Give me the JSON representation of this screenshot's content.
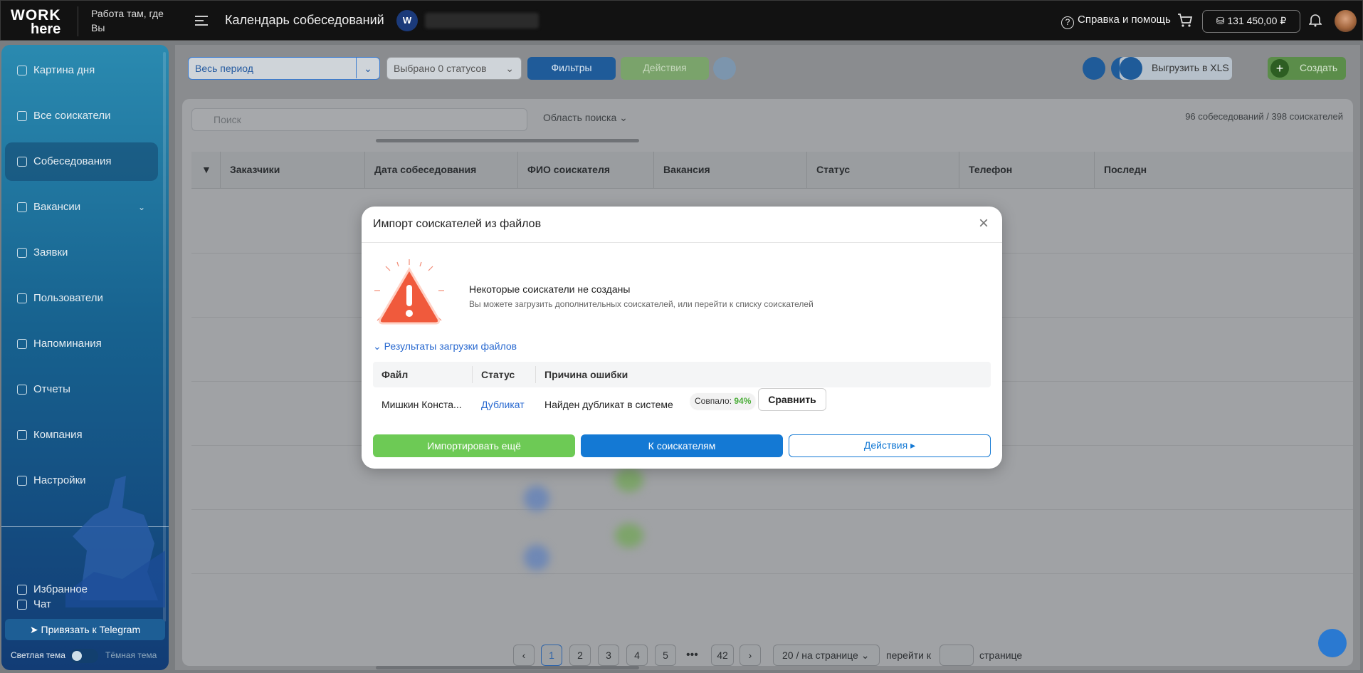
{
  "topbar": {
    "logo_top": "WORK",
    "logo_bottom": "here",
    "tagline": "Работа там, где Вы",
    "title": "Календарь собеседований",
    "company_initials": "W",
    "help_label": "Справка и помощь",
    "balance": "131 450,00 ₽",
    "icons": [
      "menu-icon",
      "cart-icon",
      "wallet-icon",
      "bell-icon",
      "help-icon"
    ]
  },
  "sidebar": {
    "items": [
      {
        "label": "Картина дня",
        "icon": "rocket-icon"
      },
      {
        "label": "Все соискатели",
        "icon": "users-icon"
      },
      {
        "label": "Собеседования",
        "icon": "calendar-icon",
        "active": true
      },
      {
        "label": "Вакансии",
        "icon": "briefcase-icon",
        "expandable": true
      },
      {
        "label": "Заявки",
        "icon": "list-icon"
      },
      {
        "label": "Пользователи",
        "icon": "user-circle-icon"
      },
      {
        "label": "Напоминания",
        "icon": "clock-icon"
      },
      {
        "label": "Отчеты",
        "icon": "chart-icon"
      },
      {
        "label": "Компания",
        "icon": "home-icon"
      },
      {
        "label": "Настройки",
        "icon": "gear-icon"
      },
      {
        "label": "Избранное",
        "icon": "grid-icon"
      },
      {
        "label": "Чат",
        "icon": "chat-icon"
      }
    ],
    "telegram_label": "Привязать к Telegram",
    "theme_light": "Светлая тема",
    "theme_dark": "Тёмная тема"
  },
  "toolbar": {
    "period": "Весь период",
    "statuses": "Выбрано 0 статусов",
    "filters": "Фильтры",
    "actions": "Действия",
    "export": "Выгрузить в XLS",
    "create": "Создать"
  },
  "table": {
    "search_placeholder": "Поиск",
    "search_area": "Область поиска",
    "counts": "96 собеседований / 398 соискателей",
    "columns": [
      "Заказчики",
      "Дата собеседования",
      "ФИО соискателя",
      "Вакансия",
      "Статус",
      "Телефон",
      "Последн"
    ]
  },
  "pagination": {
    "pages": [
      "1",
      "2",
      "3",
      "4",
      "5",
      "42"
    ],
    "current": "1",
    "dots": "•••",
    "per_page": "20 / на странице",
    "goto_prefix": "перейти к",
    "goto_suffix": "странице"
  },
  "modal": {
    "title": "Импорт соискателей из файлов",
    "warning_title": "Некоторые соискатели не созданы",
    "warning_subtitle": "Вы можете загрузить дополнительных соискателей, или перейти к списку соискателей",
    "results_toggle": "Результаты загрузки файлов",
    "headers": {
      "file": "Файл",
      "status": "Статус",
      "reason": "Причина ошибки"
    },
    "row": {
      "file": "Мишкин Конста...",
      "status": "Дубликат",
      "reason": "Найден дубликат в системе",
      "match_label": "Совпало:",
      "match_value": "94%",
      "compare": "Сравнить"
    },
    "buttons": {
      "import_more": "Импортировать ещё",
      "to_candidates": "К соискателям",
      "actions": "Действия ▸"
    }
  },
  "colors": {
    "accent_blue": "#1479d4",
    "accent_green": "#6dca55",
    "link_blue": "#2a6ad0",
    "match_green": "#4cae3a",
    "warning_red": "#f05a3c"
  }
}
